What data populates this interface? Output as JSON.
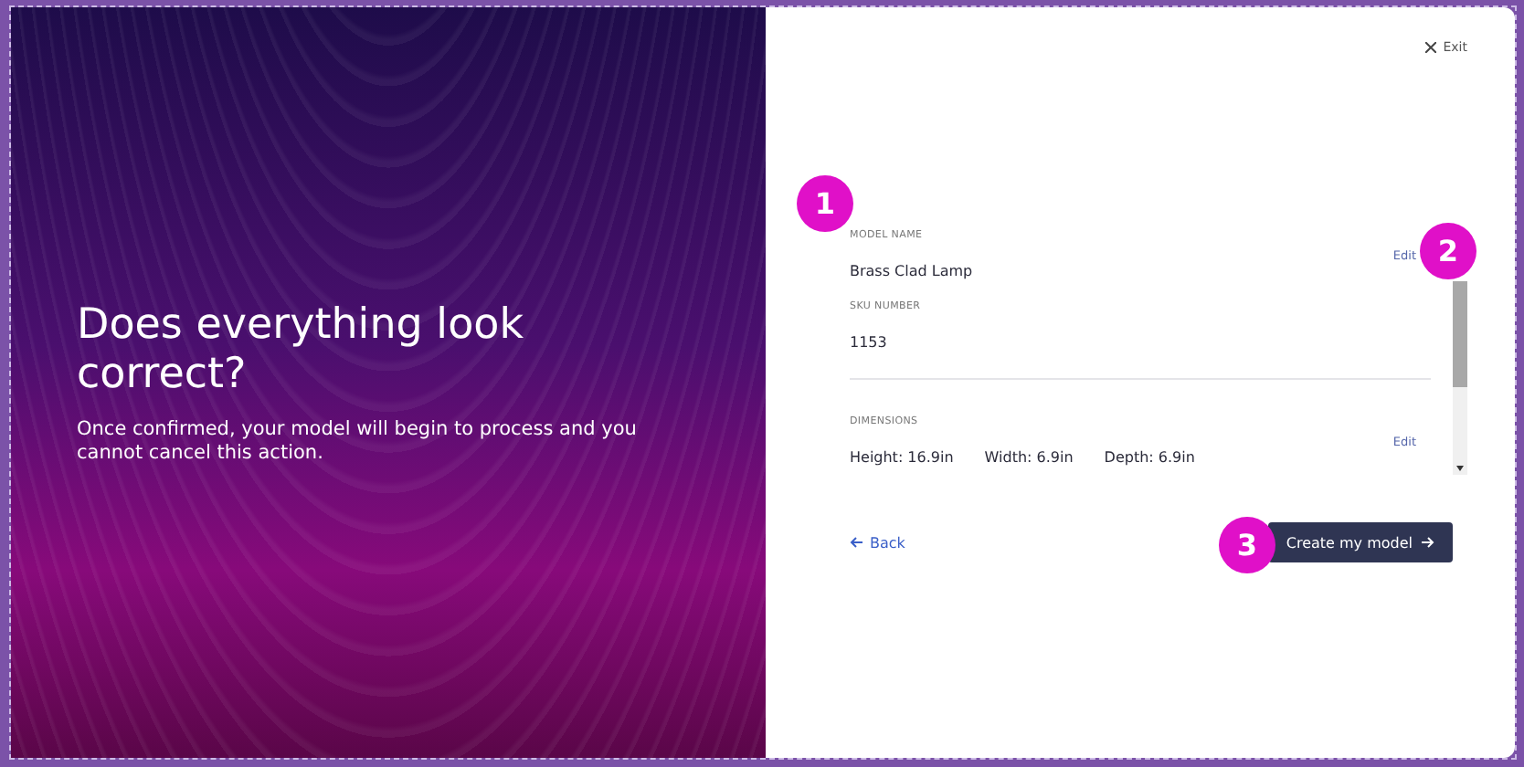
{
  "hero": {
    "title": "Does everything look correct?",
    "description": "Once confirmed, your model will begin to process and you cannot cancel this action."
  },
  "exit": {
    "label": "Exit"
  },
  "review": {
    "sections": [
      {
        "fields": [
          {
            "label": "MODEL NAME",
            "value": "Brass Clad Lamp"
          },
          {
            "label": "SKU NUMBER",
            "value": "1153"
          }
        ],
        "edit": "Edit"
      },
      {
        "fields": [
          {
            "label": "DIMENSIONS",
            "values": [
              "Height: 16.9in",
              "Width: 6.9in",
              "Depth: 6.9in"
            ]
          }
        ],
        "edit": "Edit"
      }
    ]
  },
  "back": {
    "label": "Back"
  },
  "submit": {
    "label": "Create my model"
  },
  "callouts": [
    "1",
    "2",
    "3"
  ]
}
